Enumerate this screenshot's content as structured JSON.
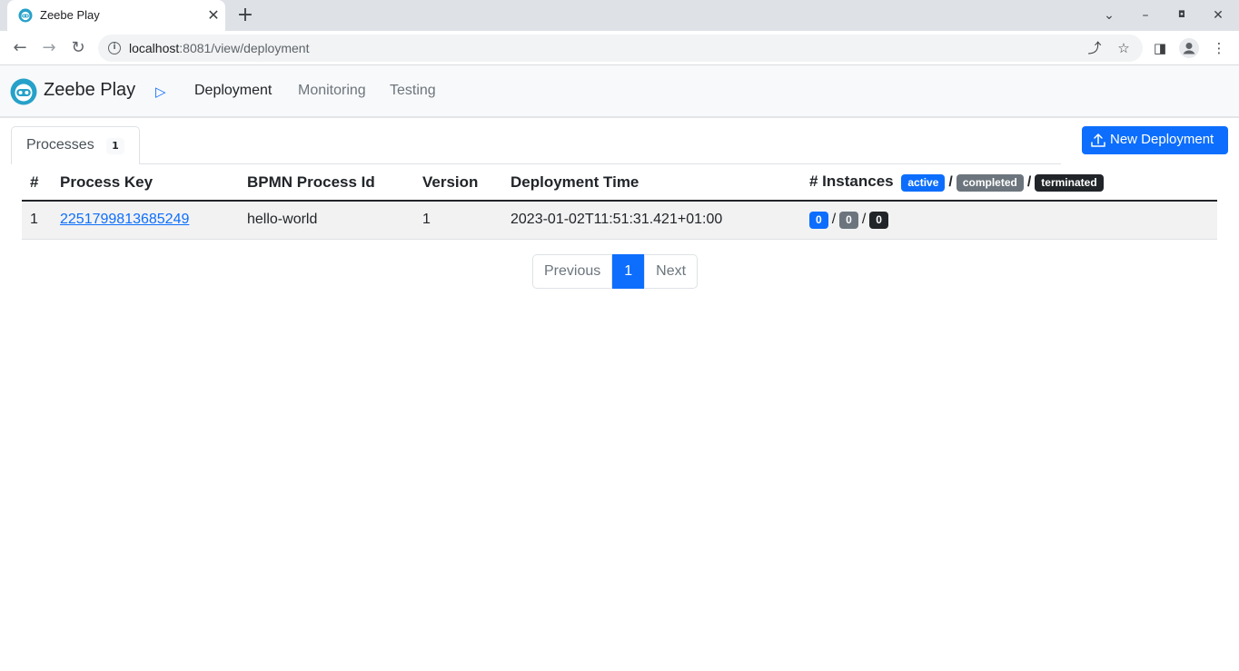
{
  "browser": {
    "tab_title": "Zeebe Play",
    "url_host": "localhost",
    "url_rest": ":8081/view/deployment"
  },
  "app": {
    "brand": "Zeebe Play",
    "nav": [
      {
        "label": "Deployment",
        "active": true
      },
      {
        "label": "Monitoring",
        "active": false
      },
      {
        "label": "Testing",
        "active": false
      }
    ]
  },
  "content": {
    "tab_label": "Processes",
    "tab_count": "1",
    "new_deployment_label": "New Deployment",
    "table": {
      "headers": {
        "index": "#",
        "process_key": "Process Key",
        "bpmn_id": "BPMN Process Id",
        "version": "Version",
        "deployment_time": "Deployment Time",
        "instances": "# Instances"
      },
      "instance_badges": {
        "active": "active",
        "completed": "completed",
        "terminated": "terminated"
      },
      "rows": [
        {
          "index": "1",
          "process_key": "2251799813685249",
          "bpmn_id": "hello-world",
          "version": "1",
          "deployment_time": "2023-01-02T11:51:31.421+01:00",
          "active": "0",
          "completed": "0",
          "terminated": "0"
        }
      ]
    },
    "pagination": {
      "previous": "Previous",
      "current": "1",
      "next": "Next"
    }
  },
  "colors": {
    "primary": "#0d6efd",
    "secondary": "#6c757d",
    "dark": "#212529"
  },
  "icons": [
    "zeebe-logo-icon",
    "play-icon",
    "upload-icon",
    "back-icon",
    "forward-icon",
    "reload-icon",
    "info-icon",
    "share-icon",
    "star-icon",
    "side-panel-icon",
    "profile-icon",
    "menu-icon"
  ]
}
